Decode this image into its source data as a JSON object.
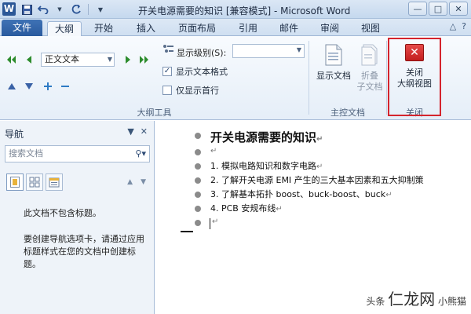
{
  "app": {
    "logo_letter": "W",
    "title": "开关电源需要的知识 [兼容模式] - Microsoft Word",
    "window_controls": [
      "—",
      "□",
      "✕"
    ]
  },
  "tabs": {
    "file": "文件",
    "items": [
      "大纲",
      "开始",
      "插入",
      "页面布局",
      "引用",
      "邮件",
      "审阅",
      "视图"
    ],
    "active_index": 0
  },
  "ribbon": {
    "outline_tools": {
      "level_value": "正文文本",
      "show_level_label": "显示级别(S):",
      "show_level_value": "",
      "show_text_format_label": "显示文本格式",
      "show_text_format_checked": true,
      "first_line_only_label": "仅显示首行",
      "first_line_only_checked": false,
      "group_label": "大纲工具"
    },
    "master_document": {
      "show_document_label": "显示文档",
      "collapse_subdocs_label": [
        "折叠",
        "子文档"
      ],
      "group_label": "主控文档"
    },
    "close": {
      "close_outline_label": [
        "关闭",
        "大纲视图"
      ],
      "group_label": "关闭"
    }
  },
  "nav": {
    "title": "导航",
    "search_placeholder": "搜索文档",
    "message_1": "此文档不包含标题。",
    "message_2": "要创建导航选项卡，请通过应用标题样式在您的文档中创建标题。"
  },
  "document": {
    "heading": "开关电源需要的知识",
    "lines": [
      "1.  模拟电路知识和数字电路",
      "2.  了解开关电源 EMI 产生的三大基本因素和五大抑制策",
      "3.  了解基本拓扑 boost、buck-boost、buck",
      "4.  PCB 安规布线"
    ],
    "para_mark": "↵"
  },
  "watermark": {
    "prefix": "头条",
    "brand": "仁龙网",
    "suffix": "小熊猫"
  },
  "colors": {
    "file_tab": "#2a5a9e",
    "close_highlight": "#d4242d",
    "close_icon": "#c21e1e"
  }
}
